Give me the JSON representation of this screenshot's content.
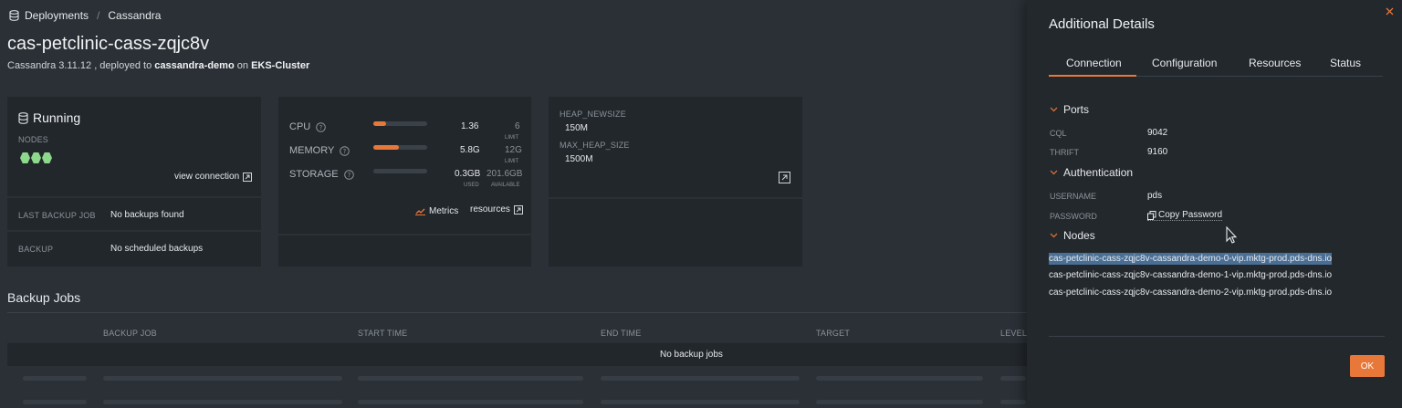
{
  "breadcrumb": {
    "root": "Deployments",
    "current": "Cassandra"
  },
  "page": {
    "title": "cas-petclinic-cass-zqjc8v",
    "subtitle_prefix": "Cassandra 3.11.12 , deployed to",
    "namespace": "cassandra-demo",
    "on_text": "on",
    "cluster": "EKS-Cluster"
  },
  "status_card": {
    "state": "Running",
    "nodes_label": "NODES",
    "node_count": 3,
    "view_connection": "view connection",
    "last_backup_label": "LAST BACKUP JOB",
    "last_backup_value": "No backups found",
    "backup_label": "BACKUP",
    "backup_value": "No scheduled backups"
  },
  "resources_card": {
    "cpu": {
      "label": "CPU",
      "value": "1.36",
      "limit": "6",
      "limit_label": "LIMIT",
      "fill": 0.23
    },
    "memory": {
      "label": "MEMORY",
      "value": "5.8G",
      "limit": "12G",
      "limit_label": "LIMIT",
      "fill": 0.48
    },
    "storage": {
      "label": "STORAGE",
      "used": "0.3GB",
      "used_label": "USED",
      "available": "201.6GB",
      "available_label": "AVAILABLE",
      "fill": 0.0
    },
    "metrics_link": "Metrics",
    "resources_link": "resources"
  },
  "config_card": {
    "items": [
      {
        "key": "HEAP_NEWSIZE",
        "value": "150M"
      },
      {
        "key": "MAX_HEAP_SIZE",
        "value": "1500M"
      }
    ]
  },
  "backup_jobs": {
    "title": "Backup Jobs",
    "columns": [
      "BACKUP JOB",
      "START TIME",
      "END TIME",
      "TARGET",
      "LEVEL"
    ],
    "empty_text": "No backup jobs"
  },
  "panel": {
    "title": "Additional Details",
    "tabs": [
      "Connection",
      "Configuration",
      "Resources",
      "Status"
    ],
    "active_tab": "Connection",
    "ports_title": "Ports",
    "ports": [
      {
        "key": "CQL",
        "value": "9042"
      },
      {
        "key": "THRIFT",
        "value": "9160"
      }
    ],
    "auth_title": "Authentication",
    "auth": {
      "username_label": "USERNAME",
      "username": "pds",
      "password_label": "PASSWORD",
      "copy_password": "Copy Password"
    },
    "nodes_title": "Nodes",
    "nodes": [
      "cas-petclinic-cass-zqjc8v-cassandra-demo-0-vip.mktg-prod.pds-dns.io",
      "cas-petclinic-cass-zqjc8v-cassandra-demo-1-vip.mktg-prod.pds-dns.io",
      "cas-petclinic-cass-zqjc8v-cassandra-demo-2-vip.mktg-prod.pds-dns.io"
    ],
    "ok_label": "OK"
  },
  "colors": {
    "accent": "#e8773a",
    "running": "#8cd98c",
    "highlight": "#4a6f96"
  }
}
